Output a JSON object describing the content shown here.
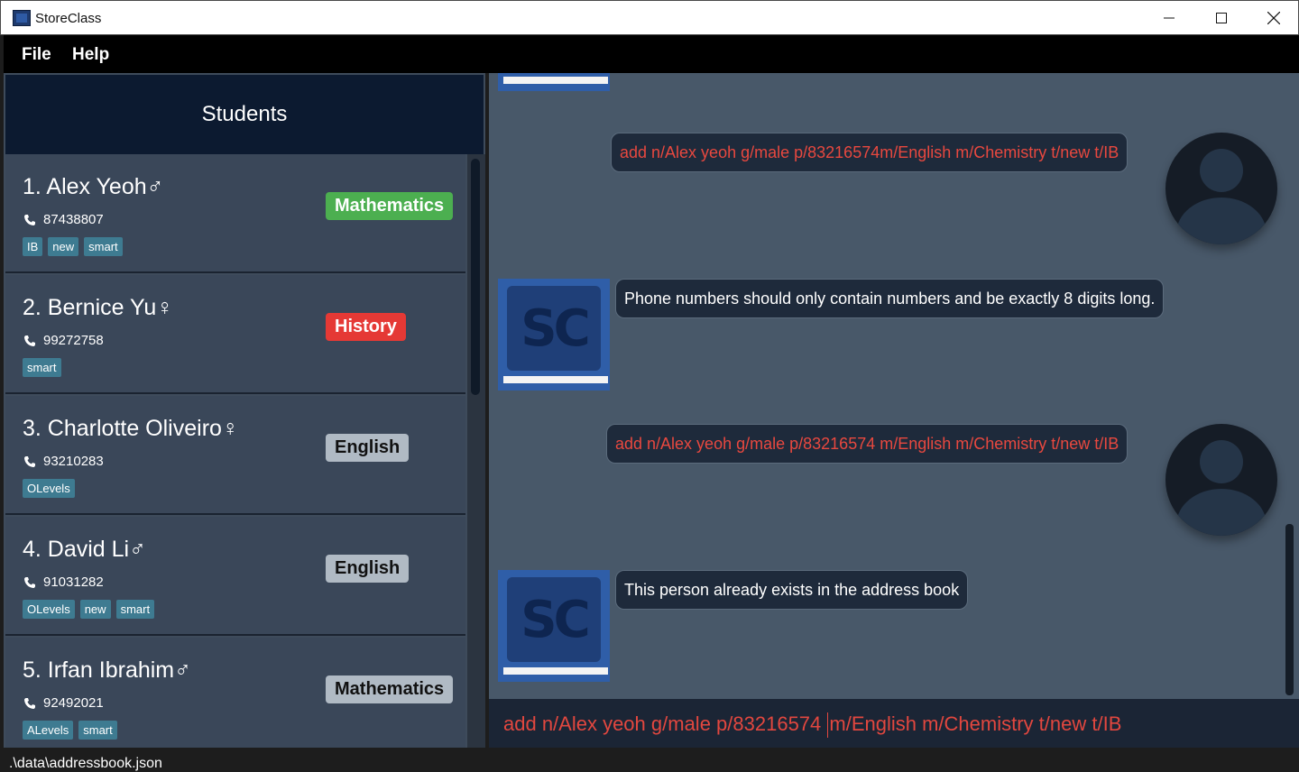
{
  "window": {
    "title": "StoreClass"
  },
  "menu": {
    "file": "File",
    "help": "Help"
  },
  "students": {
    "header": "Students",
    "items": [
      {
        "name": "1. Alex Yeoh♂",
        "phone": "87438807",
        "tags": [
          "IB",
          "new",
          "smart"
        ],
        "subject": "Mathematics",
        "subject_style": "green"
      },
      {
        "name": "2. Bernice Yu♀",
        "phone": "99272758",
        "tags": [
          "smart"
        ],
        "subject": "History",
        "subject_style": "red"
      },
      {
        "name": "3. Charlotte Oliveiro♀",
        "phone": "93210283",
        "tags": [
          "OLevels"
        ],
        "subject": "English",
        "subject_style": "grey"
      },
      {
        "name": "4. David Li♂",
        "phone": "91031282",
        "tags": [
          "OLevels",
          "new",
          "smart"
        ],
        "subject": "English",
        "subject_style": "grey"
      },
      {
        "name": "5. Irfan Ibrahim♂",
        "phone": "92492021",
        "tags": [
          "ALevels",
          "smart"
        ],
        "subject": "Mathematics",
        "subject_style": "grey"
      }
    ]
  },
  "chat": {
    "messages": [
      {
        "from": "user",
        "text": "add n/Alex yeoh g/male p/83216574m/English m/Chemistry t/new t/IB"
      },
      {
        "from": "bot",
        "text": "Phone numbers should only contain numbers and be exactly 8 digits long."
      },
      {
        "from": "user",
        "text": "add n/Alex yeoh g/male p/83216574 m/English m/Chemistry t/new t/IB"
      },
      {
        "from": "bot",
        "text": "This person already exists in the address book"
      }
    ],
    "bot_avatar_label": "SC"
  },
  "command": {
    "before_caret": "add n/Alex yeoh g/male p/83216574 ",
    "after_caret": "m/English m/Chemistry t/new t/IB"
  },
  "status": {
    "path": ".\\data\\addressbook.json"
  },
  "colors": {
    "green": "#4caf50",
    "red": "#e53935",
    "grey": "#b0bac4",
    "error_text": "#e8483f"
  }
}
